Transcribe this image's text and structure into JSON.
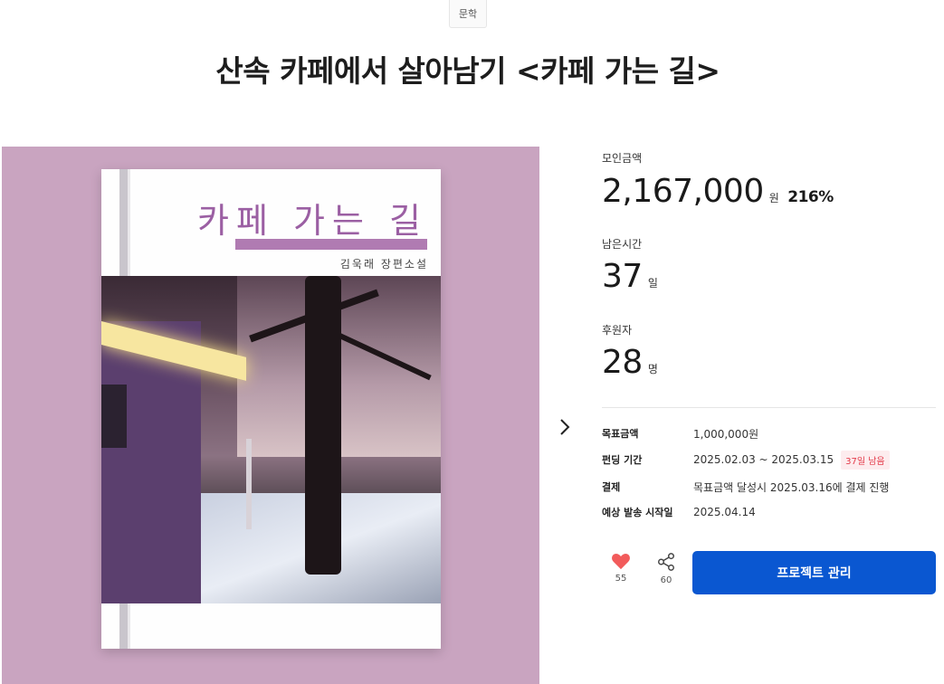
{
  "category": "문학",
  "title": "산속 카페에서 살아남기 <카페 가는 길>",
  "cover": {
    "book_title": "카페 가는 길",
    "book_author": "김욱래 장편소설"
  },
  "stats": {
    "funding_label": "모인금액",
    "funding_value": "2,167,000",
    "funding_unit": "원",
    "funding_percent": "216%",
    "remaining_label": "남은시간",
    "remaining_value": "37",
    "remaining_unit": "일",
    "backers_label": "후원자",
    "backers_value": "28",
    "backers_unit": "명"
  },
  "info": {
    "goal_key": "목표금액",
    "goal_value": "1,000,000원",
    "period_key": "펀딩 기간",
    "period_value": "2025.02.03 ~ 2025.03.15",
    "period_badge": "37일 남음",
    "payment_key": "결제",
    "payment_value": "목표금액 달성시 2025.03.16에 결제 진행",
    "ship_key": "예상 발송 시작일",
    "ship_value": "2025.04.14"
  },
  "actions": {
    "like_count": "55",
    "share_count": "60",
    "manage_label": "프로젝트 관리"
  },
  "colors": {
    "accent": "#0a57d1",
    "heart": "#f25b5b",
    "badge_text": "#e43b4a",
    "hero_bg": "#c9a4c0"
  },
  "icons": {
    "like": "heart-icon",
    "share": "share-icon",
    "next": "chevron-right-icon"
  }
}
